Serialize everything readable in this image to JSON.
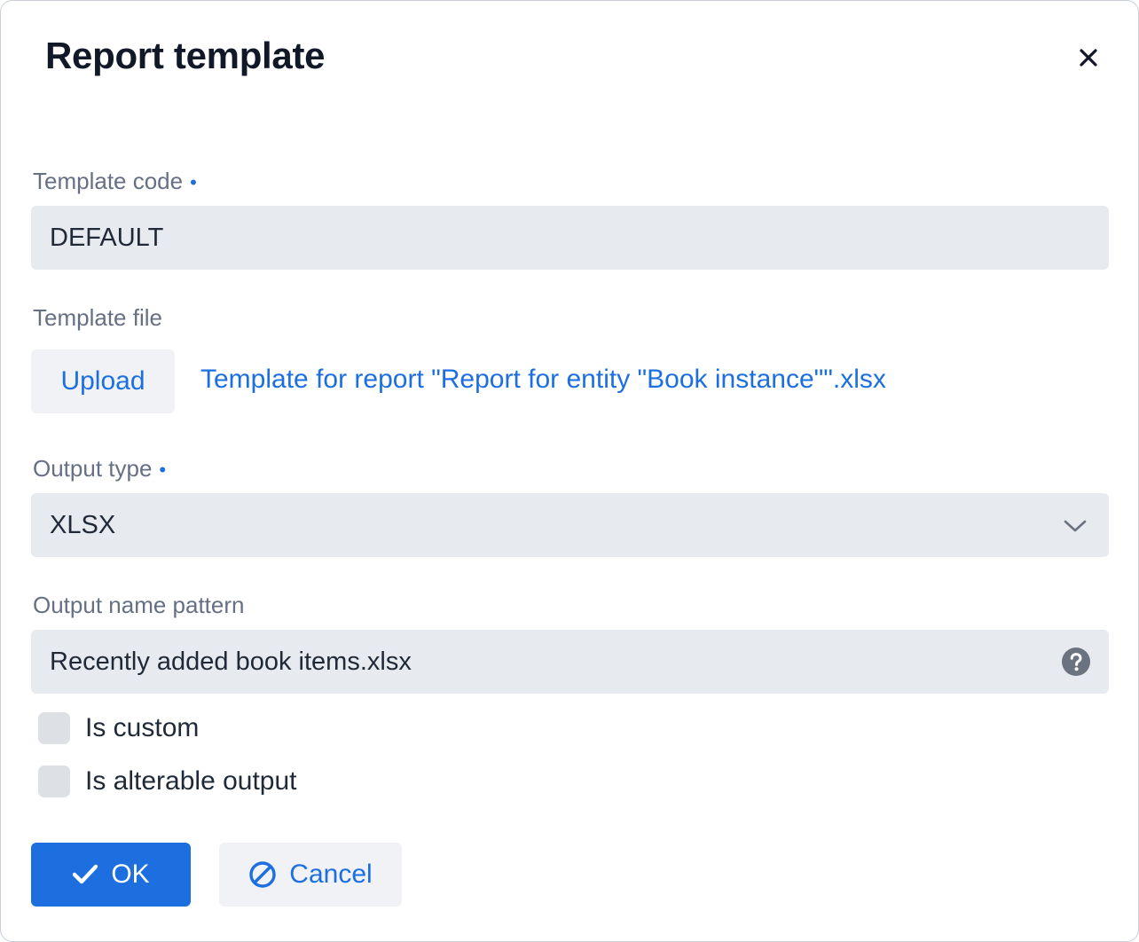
{
  "dialog": {
    "title": "Report template"
  },
  "fields": {
    "template_code": {
      "label": "Template code",
      "required_marker": "•",
      "value": "DEFAULT"
    },
    "template_file": {
      "label": "Template file",
      "upload_label": "Upload",
      "file_name": "Template for report \"Report for entity \"Book instance\"\".xlsx"
    },
    "output_type": {
      "label": "Output type",
      "required_marker": "•",
      "value": "XLSX"
    },
    "output_name_pattern": {
      "label": "Output name pattern",
      "value": "Recently added book items.xlsx"
    },
    "is_custom": {
      "label": "Is custom",
      "checked": false
    },
    "is_alterable_output": {
      "label": "Is alterable output",
      "checked": false
    }
  },
  "actions": {
    "ok_label": "OK",
    "cancel_label": "Cancel"
  },
  "colors": {
    "accent": "#1d6fe0",
    "input_bg": "#e7eaee",
    "label": "#667085"
  },
  "icons": {
    "close": "close-icon",
    "dropdown": "chevron-down-icon",
    "help": "help-circle-icon",
    "ok": "check-icon",
    "cancel": "ban-icon"
  }
}
